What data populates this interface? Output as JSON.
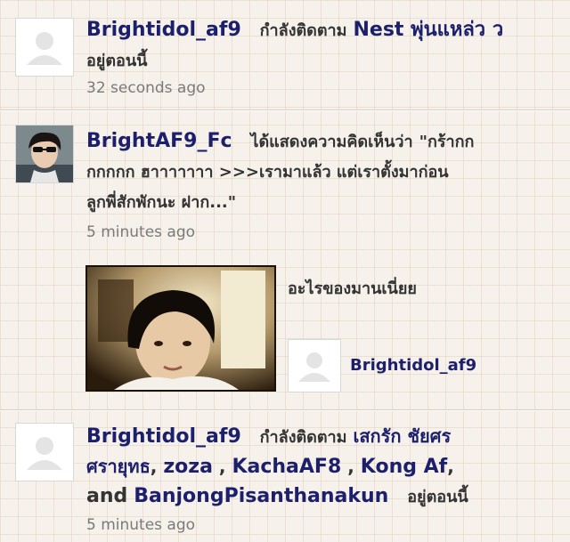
{
  "feed": [
    {
      "username": "Brightidol_af9",
      "action": "กำลังติดตาม",
      "target": "Nest พุ่นแหล่ว ว",
      "suffix": "อยู่ตอนนี้",
      "timestamp": "32 seconds ago",
      "avatar_icon": "default-user-icon"
    },
    {
      "username": "BrightAF9_Fc",
      "action": "ได้แสดงความคิดเห็นว่า",
      "comment_line1": "\"กร้ากก",
      "comment_line2": "กกกกก ฮาาาาาาา >>>เรามาแล้ว แต่เราตั้งมาก่อน",
      "comment_line3": "ลูกพี่สักพักนะ ฝาก...\"",
      "timestamp": "5 minutes ago",
      "photo_caption": "อะไรของมานเนี่ยย",
      "photo_author": "Brightidol_af9",
      "avatar_icon": "profile-photo"
    },
    {
      "username": "Brightidol_af9",
      "action": "กำลังติดตาม",
      "targets_line1": "เสกรัก ชัยศร",
      "targets_line2_a": "ศรายุทธ",
      "targets_line2_b": "zoza",
      "targets_line2_c": "KachaAF8",
      "targets_line2_d": "Kong Af",
      "and_text": "and",
      "target_last": "BanjongPisanthanakun",
      "suffix": "อยู่ตอนนี้",
      "timestamp": "5 minutes ago",
      "avatar_icon": "default-user-icon"
    }
  ],
  "colors": {
    "link": "#1c1f6b",
    "text": "#333333",
    "timestamp": "#7a7a7a",
    "background": "#f6f1ea"
  }
}
